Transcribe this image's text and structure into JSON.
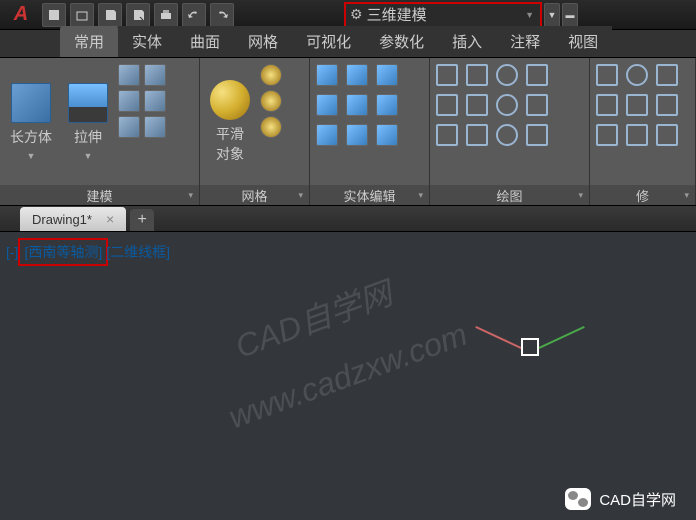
{
  "app": {
    "logo_text": "A"
  },
  "workspace": {
    "label": "三维建模"
  },
  "tabs": [
    "常用",
    "实体",
    "曲面",
    "网格",
    "可视化",
    "参数化",
    "插入",
    "注释",
    "视图"
  ],
  "panels": {
    "modeling": {
      "title": "建模",
      "box": "长方体",
      "extrude": "拉伸"
    },
    "mesh": {
      "title": "网格",
      "smooth_l1": "平滑",
      "smooth_l2": "对象"
    },
    "solidedit": {
      "title": "实体编辑"
    },
    "draw": {
      "title": "绘图"
    },
    "modify": {
      "title": "修"
    }
  },
  "file_tab": {
    "name": "Drawing1*",
    "close": "×",
    "new": "+"
  },
  "viewport": {
    "bracket": "[-]",
    "view": "[西南等轴测]",
    "style": "[二维线框]"
  },
  "watermark": "www.cadzxw.com",
  "watermark2": "CAD自学网",
  "brand": "CAD自学网"
}
